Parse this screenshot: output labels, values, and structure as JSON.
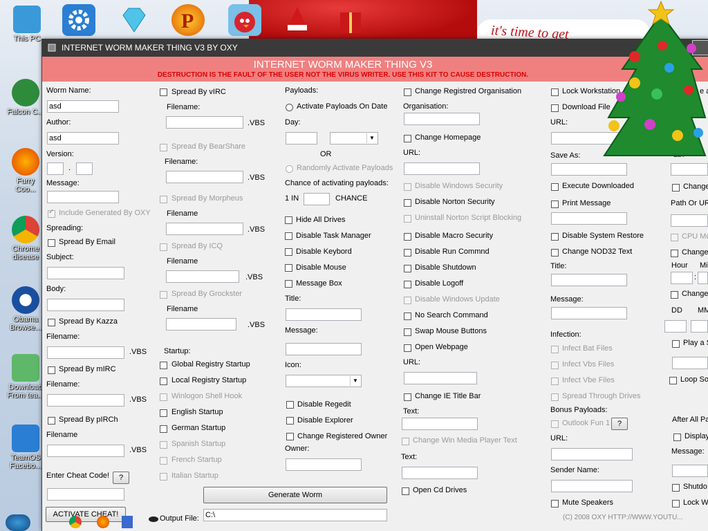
{
  "banner": {
    "text": "it's time to get"
  },
  "desktop_icons": [
    {
      "label": "This PC"
    },
    {
      "label": "Falcon C..."
    },
    {
      "label": "Furry Coo..."
    },
    {
      "label": "Chrome disease"
    },
    {
      "label": "Obama Browse..."
    },
    {
      "label": "Download From tea..."
    },
    {
      "label": "TeamOS Facebo..."
    }
  ],
  "window": {
    "title": "INTERNET WORM MAKER THING V3  BY OXY"
  },
  "header": {
    "title": "INTERNET WORM MAKER THING V3",
    "warning": "DESTRUCTION IS THE FAULT OF THE USER NOT THE VIRUS WRITER. USE THIS KIT TO CAUSE DESTRUCTION."
  },
  "col1": {
    "worm_name_label": "Worm Name:",
    "worm_name_value": "asd",
    "author_label": "Author:",
    "author_value": "asd",
    "version_label": "Version:",
    "version_dot": ".",
    "message_label": "Message:",
    "include_generated": "Include Generated By OXY",
    "spreading_label": "Spreading:",
    "spread_email": "Spread By Email",
    "subject_label": "Subject:",
    "body_label": "Body:",
    "spread_kazza": "Spread By Kazza",
    "filename1_label": "Filename:",
    "vbs1": ".VBS",
    "spread_mirc": "Spread By mIRC",
    "filename2_label": "Filename:",
    "vbs2": ".VBS",
    "spread_pirch": "Spread By pIRCh",
    "filename3_label": "Filename",
    "vbs3": ".VBS",
    "cheat_label": "Enter Cheat Code!",
    "cheat_help": "?",
    "activate_cheat": "ACTIVATE CHEAT!"
  },
  "col2": {
    "spread_virc": "Spread By vIRC",
    "fn1": "Filename:",
    "vbs1": ".VBS",
    "spread_bearshare": "Spread By BearShare",
    "fn2": "Filename:",
    "vbs2": ".VBS",
    "spread_morpheus": "Spread By Morpheus",
    "fn3": "Filename",
    "vbs3": ".VBS",
    "spread_icq": "Spread By ICQ",
    "fn4": "Filename",
    "vbs4": ".VBS",
    "spread_grockster": "Spread By Grockster",
    "fn5": "Filename",
    "vbs5": ".VBS",
    "startup_label": "Startup:",
    "global_registry": "Global Registry Startup",
    "local_registry": "Local Registry Startup",
    "winlogon": "Winlogon Shell Hook",
    "english": "English Startup",
    "german": "German Startup",
    "spanish": "Spanish Startup",
    "french": "French Startup",
    "italian": "Italian Startup",
    "output_label": "Output File:",
    "output_value": "C:\\"
  },
  "col3": {
    "payloads_label": "Payloads:",
    "activate_on_date": "Activate Payloads On Date",
    "day_label": "Day:",
    "or_label": "OR",
    "randomly_activate": "Randomly Activate Payloads",
    "chance_label": "Chance of activating payloads:",
    "one_in": "1 IN",
    "chance": "CHANCE",
    "hide_drives": "Hide All Drives",
    "disable_task_manager": "Disable Task Manager",
    "disable_keyboard": "Disable Keybord",
    "disable_mouse": "Disable Mouse",
    "message_box": "Message Box",
    "title_label": "Title:",
    "message_label": "Message:",
    "icon_label": "Icon:",
    "disable_regedit": "Disable Regedit",
    "disable_explorer": "Disable Explorer",
    "change_owner": "Change Registered Owner",
    "owner_label": "Owner:",
    "generate_button": "Generate Worm"
  },
  "col4": {
    "change_org": "Change Registred Organisation",
    "org_label": "Organisation:",
    "change_homepage": "Change Homepage",
    "url1_label": "URL:",
    "disable_win_security": "Disable Windows Security",
    "disable_norton": "Disable Norton Security",
    "uninstall_norton": "Uninstall Norton Script Blocking",
    "disable_macro": "Disable Macro Security",
    "disable_run": "Disable Run Commnd",
    "disable_shutdown": "Disable Shutdown",
    "disable_logoff": "Disable Logoff",
    "disable_update": "Disable Windows Update",
    "no_search": "No Search Command",
    "swap_mouse": "Swap Mouse Buttons",
    "open_webpage": "Open Webpage",
    "url2_label": "URL:",
    "change_ie_title": "Change IE Title Bar",
    "text1_label": "Text:",
    "change_wmp_text": "Change Win Media Player Text",
    "text2_label": "Text:",
    "open_cd": "Open Cd Drives"
  },
  "col5": {
    "lock_workstation": "Lock Workstation",
    "download_file": "Download File",
    "url_label": "URL:",
    "save_as_label": "Save As:",
    "execute_downloaded": "Execute Downloaded",
    "print_message": "Print Message",
    "disable_restore": "Disable System Restore",
    "change_nod32": "Change NOD32 Text",
    "title_label": "Title:",
    "message_label": "Message:",
    "infection_label": "Infection:",
    "infect_bat": "Infect Bat Files",
    "infect_vbs": "Infect Vbs Files",
    "infect_vbe": "Infect Vbe Files",
    "spread_drives": "Spread Through Drives",
    "bonus_label": "Bonus Payloads:",
    "outlook_fun": "Outlook Fun 1",
    "outlook_help": "?",
    "url2_label": "URL:",
    "sender_label": "Sender Name:",
    "mute_speakers": "Mute Speakers"
  },
  "col6": {
    "create_partial": "e a",
    "path_partial": "ath",
    "change1": "Change",
    "path_or_url": "Path Or UR",
    "cpu_monitor": "CPU Mon",
    "change2": "Change",
    "hour": "Hour",
    "min": "Mi",
    "colon": ":",
    "change3": "Change",
    "dd": "DD",
    "mm": "MM",
    "play_a": "Play a S",
    "loop_so": "Loop So",
    "after_all": "After All Pa",
    "display": "Display",
    "message_label": "Message:",
    "shutdown": "Shutdo",
    "lock_w": "Lock W"
  },
  "footer": {
    "copyright": "(C) 2008 OXY HTTP://WWW.YOUTU..."
  }
}
